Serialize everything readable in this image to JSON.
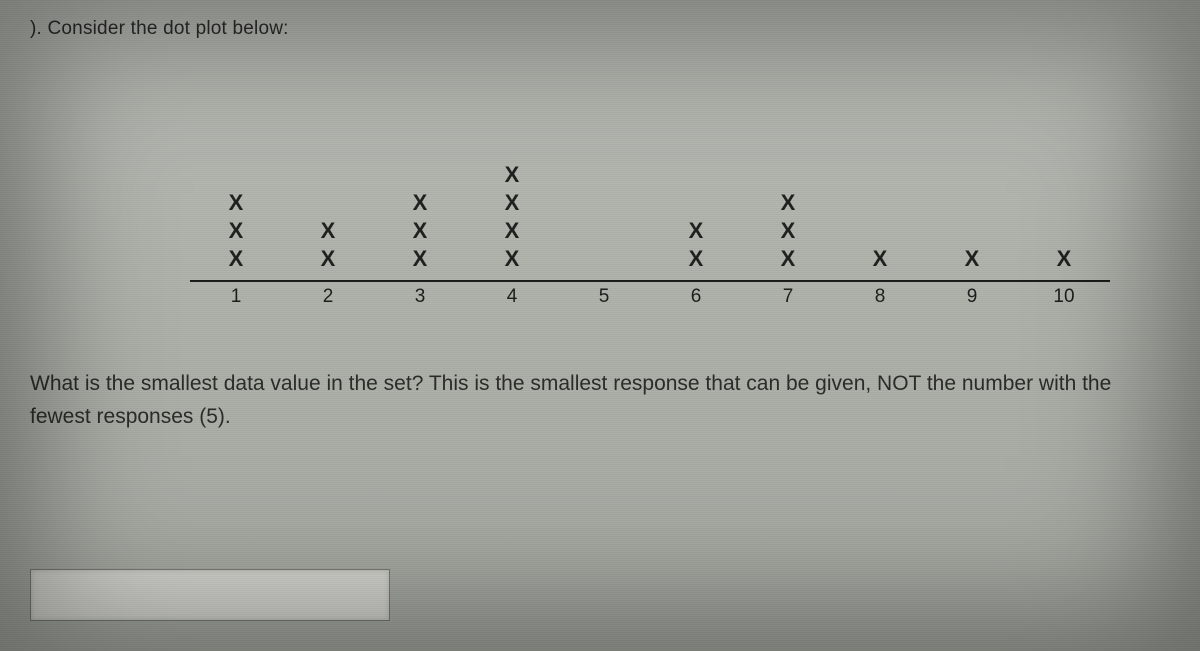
{
  "prompt": "). Consider the dot plot below:",
  "question": "What is the smallest data value in the set? This is the smallest response that can be given, NOT the number with the fewest responses (5).",
  "answer_value": "",
  "chart_data": {
    "type": "bar",
    "title": "",
    "xlabel": "",
    "ylabel": "",
    "ylim": [
      0,
      4
    ],
    "mark_glyph": "X",
    "categories": [
      "1",
      "2",
      "3",
      "4",
      "5",
      "6",
      "7",
      "8",
      "9",
      "10"
    ],
    "values": [
      3,
      2,
      3,
      4,
      0,
      2,
      3,
      1,
      1,
      1
    ]
  }
}
